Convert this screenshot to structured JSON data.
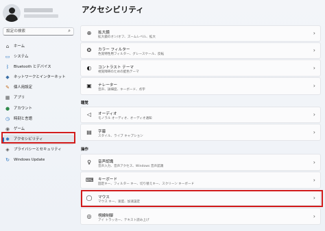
{
  "sidebar": {
    "search_placeholder": "設定の検索",
    "items": [
      {
        "label": "ホーム",
        "icon": "home-icon",
        "glyph": "⌂"
      },
      {
        "label": "システム",
        "icon": "system-icon",
        "glyph": "▭"
      },
      {
        "label": "Bluetooth とデバイス",
        "icon": "bluetooth-icon",
        "glyph": "ᛒ"
      },
      {
        "label": "ネットワークとインターネット",
        "icon": "network-icon",
        "glyph": "◆"
      },
      {
        "label": "個人用設定",
        "icon": "personalization-icon",
        "glyph": "✎"
      },
      {
        "label": "アプリ",
        "icon": "apps-icon",
        "glyph": "▦"
      },
      {
        "label": "アカウント",
        "icon": "account-icon",
        "glyph": "●"
      },
      {
        "label": "時刻と言語",
        "icon": "time-language-icon",
        "glyph": "◷"
      },
      {
        "label": "ゲーム",
        "icon": "gaming-icon",
        "glyph": "◉"
      },
      {
        "label": "アクセシビリティ",
        "icon": "accessibility-icon",
        "glyph": "✱"
      },
      {
        "label": "プライバシーとセキュリティ",
        "icon": "privacy-shield-icon",
        "glyph": "◈"
      },
      {
        "label": "Windows Update",
        "icon": "windows-update-icon",
        "glyph": "↻"
      }
    ]
  },
  "main": {
    "title": "アクセシビリティ",
    "sections": {
      "hearing": "聴覚",
      "interaction": "操作"
    },
    "cards": [
      {
        "title": "拡大鏡",
        "desc": "拡大鏡のオン/オフ、ズームレベル、拡大",
        "icon": "magnifier-icon",
        "glyph": "⊕"
      },
      {
        "title": "カラー フィルター",
        "desc": "色覚特性用フィルター、グレースケール、反転",
        "icon": "color-filter-icon",
        "glyph": "❂"
      },
      {
        "title": "コントラスト テーマ",
        "desc": "視覚障碍のための配色テーマ",
        "icon": "contrast-icon",
        "glyph": "◐"
      },
      {
        "title": "ナレーター",
        "desc": "音声、詳細度、キーボード、点字",
        "icon": "narrator-icon",
        "glyph": "▣"
      },
      {
        "title": "オーディオ",
        "desc": "モノラル オーディオ、オーディオ通知",
        "icon": "audio-icon",
        "glyph": "◁"
      },
      {
        "title": "字幕",
        "desc": "スタイル、ライブ キャプション",
        "icon": "captions-icon",
        "glyph": "▤"
      },
      {
        "title": "音声認識",
        "desc": "音声入力、音声アクセス、Windows 音声認識",
        "icon": "microphone-icon",
        "glyph": "♀"
      },
      {
        "title": "キーボード",
        "desc": "固定キー、フィルター キー、切り替えキー、スクリーン キーボード",
        "icon": "keyboard-icon",
        "glyph": "⌨"
      },
      {
        "title": "マウス",
        "desc": "マウス キー、速度、加速設定",
        "icon": "mouse-icon",
        "glyph": "◯"
      },
      {
        "title": "視線制御",
        "desc": "アイ トラッカー、テキスト読み上げ",
        "icon": "eye-control-icon",
        "glyph": "◎"
      }
    ]
  },
  "highlight_color": "#d21a1a",
  "accent_color": "#1f6fbf"
}
